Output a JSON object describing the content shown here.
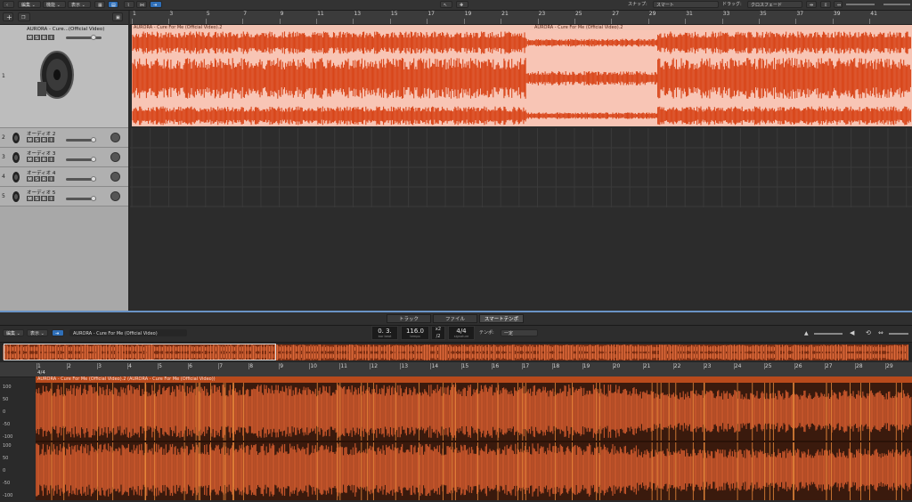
{
  "toolbar": {
    "edit": "編集",
    "function": "機能",
    "view": "表示",
    "snap_label": "スナップ:",
    "snap_value": "スマート",
    "drag_label": "ドラッグ:",
    "drag_value": "クロスフェード"
  },
  "ruler_bars": [
    "1",
    "3",
    "5",
    "7",
    "9",
    "11",
    "13",
    "15",
    "17",
    "19",
    "21",
    "23",
    "25",
    "27",
    "29",
    "31",
    "33",
    "35",
    "37",
    "39",
    "41"
  ],
  "tracks": [
    {
      "num": "1",
      "name": "AURORA - Cure...(Official Video)",
      "m": "M",
      "s": "S",
      "r": "R",
      "i": "I"
    },
    {
      "num": "2",
      "name": "オーディオ 2",
      "m": "M",
      "s": "S",
      "r": "R",
      "i": "I"
    },
    {
      "num": "3",
      "name": "オーディオ 3",
      "m": "M",
      "s": "S",
      "r": "R",
      "i": "I"
    },
    {
      "num": "4",
      "name": "オーディオ 4",
      "m": "M",
      "s": "S",
      "r": "R",
      "i": "I"
    },
    {
      "num": "5",
      "name": "オーディオ 5",
      "m": "M",
      "s": "S",
      "r": "R",
      "i": "I"
    }
  ],
  "regions": {
    "region1_name": "AURORA - Cure For Me (Official Video).2",
    "region2_name": "AURORA - Cure For Me (Official Video).2"
  },
  "editor": {
    "tabs": [
      "トラック",
      "ファイル",
      "スマートテンポ"
    ],
    "active_tab": "スマートテンポ",
    "edit": "編集",
    "view": "表示",
    "region_title": "AURORA - Cure For Me (Official Video)",
    "position": "0. 3.",
    "position_sub": "bar  beat",
    "tempo": "116.0",
    "tempo_sub": "tempo",
    "x2": "x2",
    "div2": "/2",
    "signature": "4/4",
    "signature_sub": "signature",
    "tempo_label": "テンポ:",
    "tempo_mode": "一定",
    "ruler_bars": [
      "1",
      "2",
      "3",
      "4",
      "5",
      "6",
      "7",
      "8",
      "9",
      "10",
      "11",
      "12",
      "13",
      "14",
      "15",
      "16",
      "17",
      "18",
      "19",
      "20",
      "21",
      "22",
      "23",
      "24",
      "25",
      "26",
      "27",
      "28",
      "29"
    ],
    "time_sig_marker": "4/4",
    "region_header": "AURORA - Cure For Me (Official Video).2 (AURORA - Cure For Me (Official Video))",
    "scale": [
      "100",
      "50",
      "0",
      "-50",
      "-100",
      "100",
      "50",
      "0",
      "-50",
      "-100"
    ]
  },
  "colors": {
    "region_fill": "#f8c5b5",
    "waveform": "#d8461a",
    "editor_wave": "#c2542a",
    "accent": "#2f6fb8"
  }
}
